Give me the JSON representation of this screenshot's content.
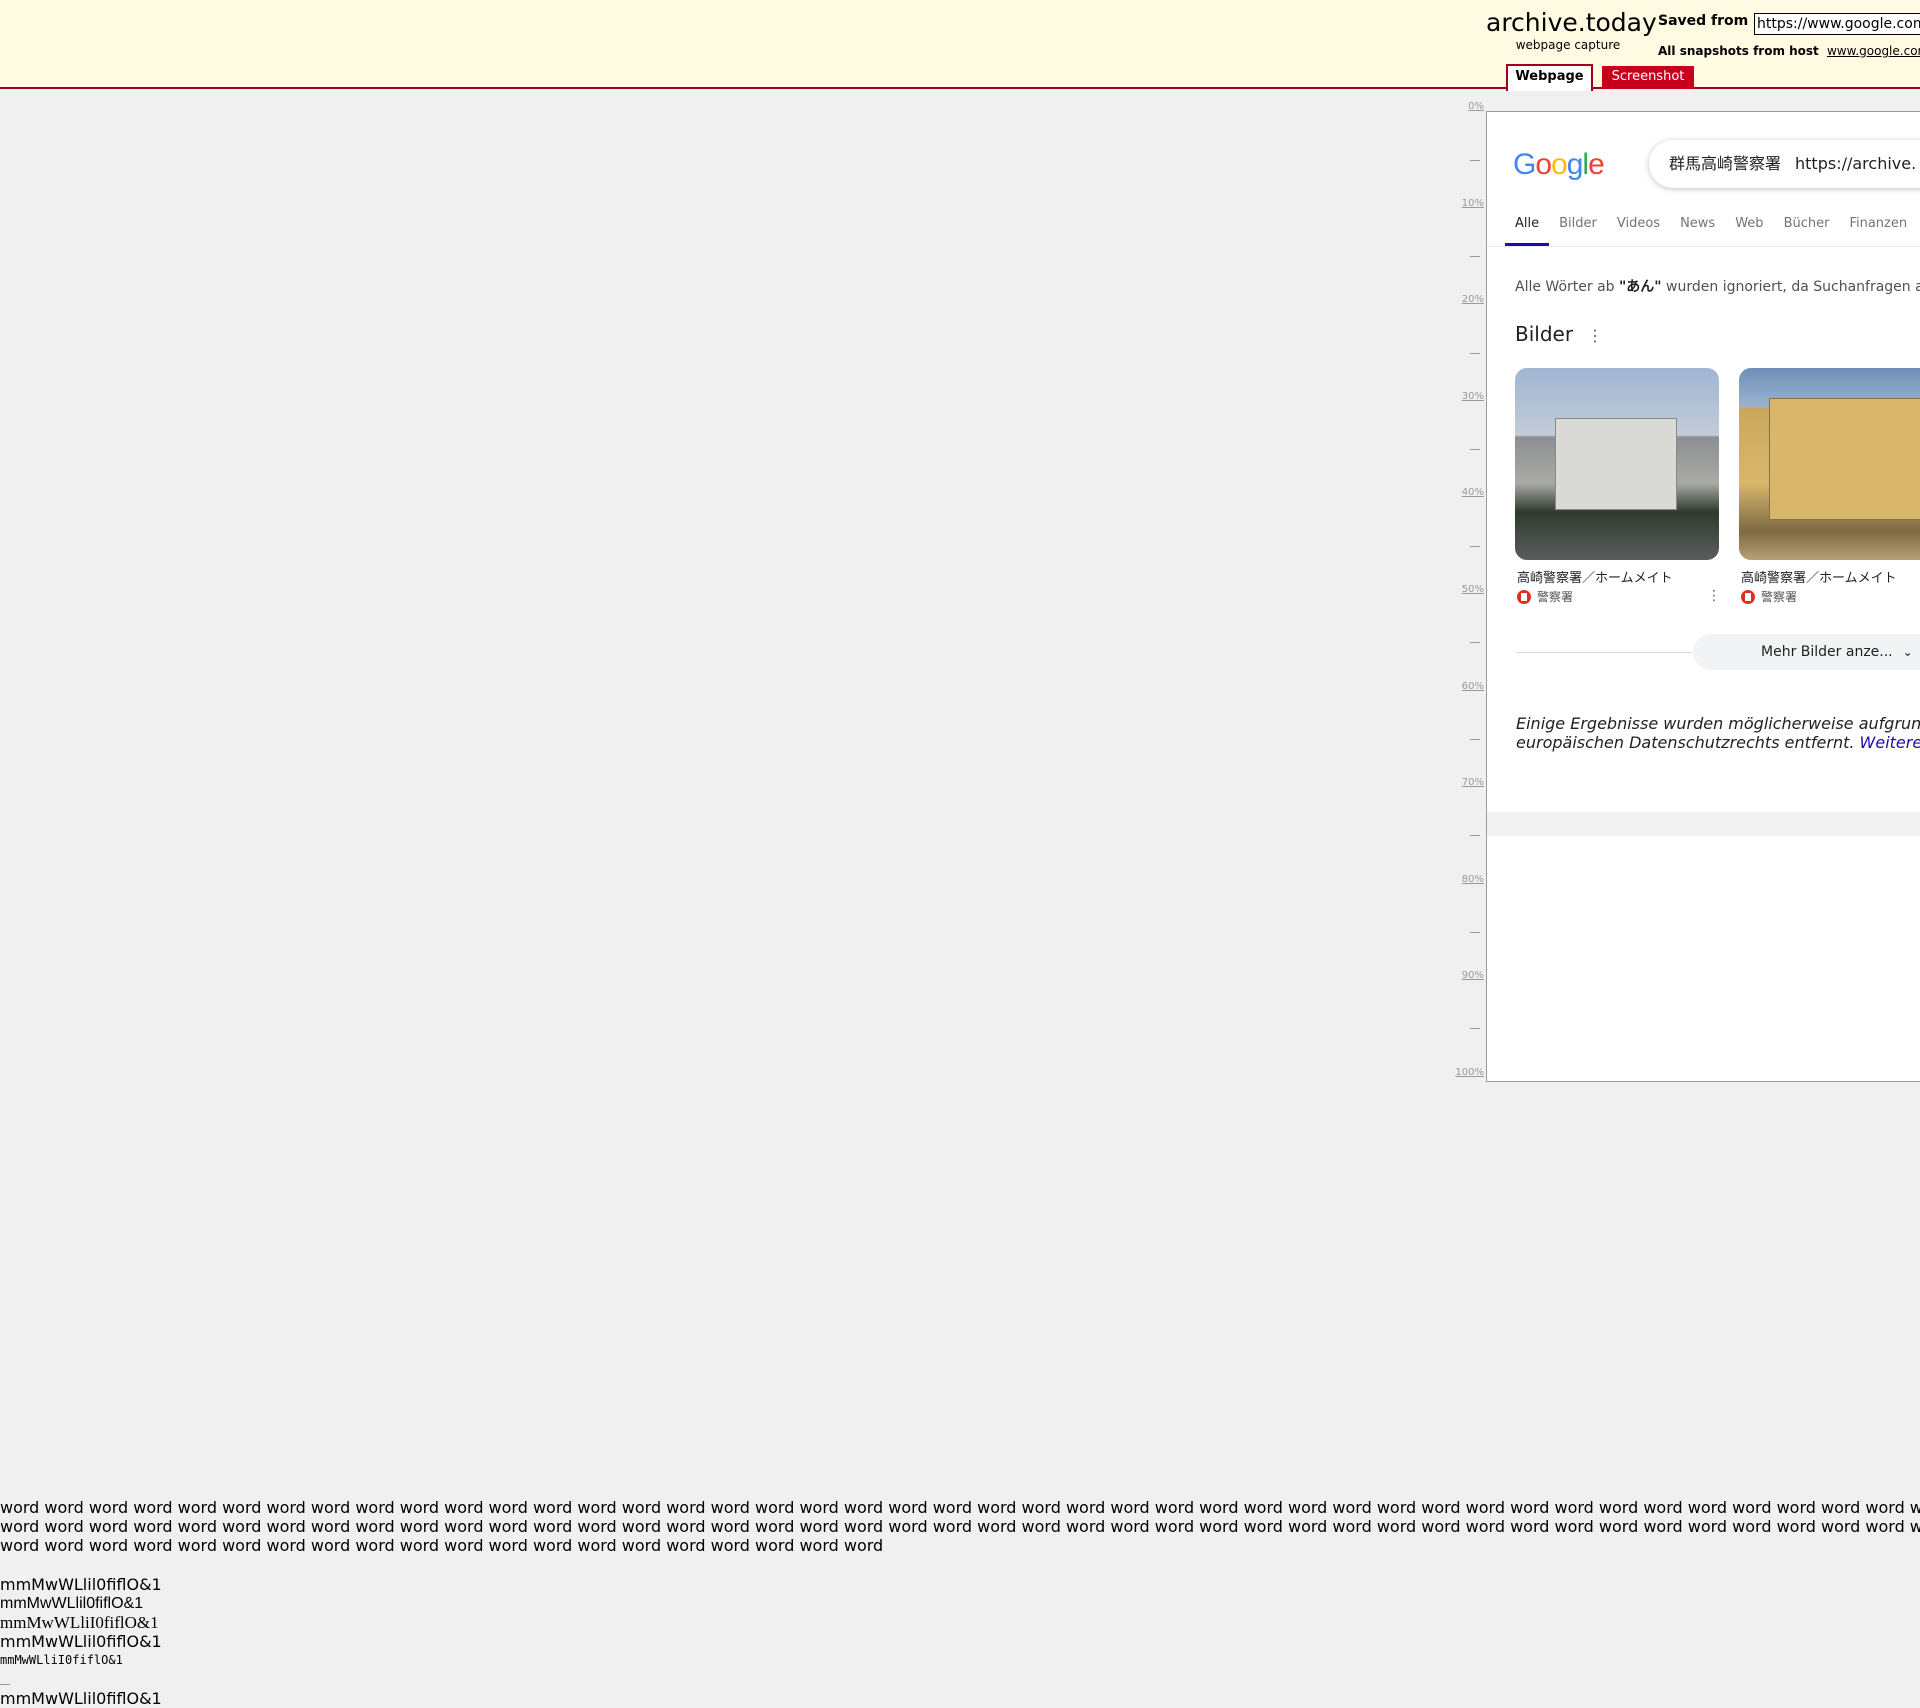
{
  "header": {
    "brand_name": "archive.today",
    "brand_sub": "webpage capture",
    "saved_from_label": "Saved from",
    "saved_url": "https://www.google.com/",
    "snapshots_label": "All snapshots",
    "from_host_label": "from host",
    "host_link": "www.google.com",
    "tabs": [
      {
        "label": "Webpage",
        "active": true
      },
      {
        "label": "Screenshot",
        "active": false
      }
    ],
    "accent_color": "#a0001c",
    "background_color": "#fffae1"
  },
  "ruler": {
    "labels": [
      "0%",
      "10%",
      "20%",
      "30%",
      "40%",
      "50%",
      "60%",
      "70%",
      "80%",
      "90%",
      "100%"
    ]
  },
  "captured_page": {
    "logo_text": "Google",
    "search_query": "群馬高崎警察署",
    "search_url": "https://archive.",
    "nav_tabs": [
      "Alle",
      "Bilder",
      "Videos",
      "News",
      "Web",
      "Bücher",
      "Finanzen"
    ],
    "active_nav": "Alle",
    "notice_prefix": "Alle Wörter ab ",
    "notice_quoted": "\"あん\"",
    "notice_suffix": " wurden ignoriert, da Suchanfragen a",
    "images_heading": "Bilder",
    "image_results": [
      {
        "caption": "高崎警察署／ホームメイト",
        "source": "警察署"
      },
      {
        "caption": "高崎警察署／ホームメイト",
        "source": "警察署"
      }
    ],
    "more_images_label": "Mehr Bilder anze...",
    "privacy_line1": "Einige Ergebnisse wurden möglicherweise aufgrun",
    "privacy_line2": "europäischen Datenschutzrechts entfernt.",
    "privacy_link": "Weitere"
  },
  "font_test": {
    "words_line1": "word word word word word word word word word word word word word word word word word word word word word word word word word word word word word word word word word word word word word word word word word word word w",
    "words_line2": "word word word word word word word word word word word word word word word word word word word word word word word word word word word word word word word word word word word word word word word word word word word w",
    "words_line3": "word word word word word word word word word word word word word word word word word word word word",
    "samples": [
      "mmMwWLlil0fiflO&1",
      "mmMwWLlil0fiflO&1",
      "mmMwWLliI0fiflO&1",
      "mmMwWLlil0fiflO&1",
      "mmMwWLliI0fiflO&1",
      "mmMwWLlil0fiflO&1"
    ]
  }
}
